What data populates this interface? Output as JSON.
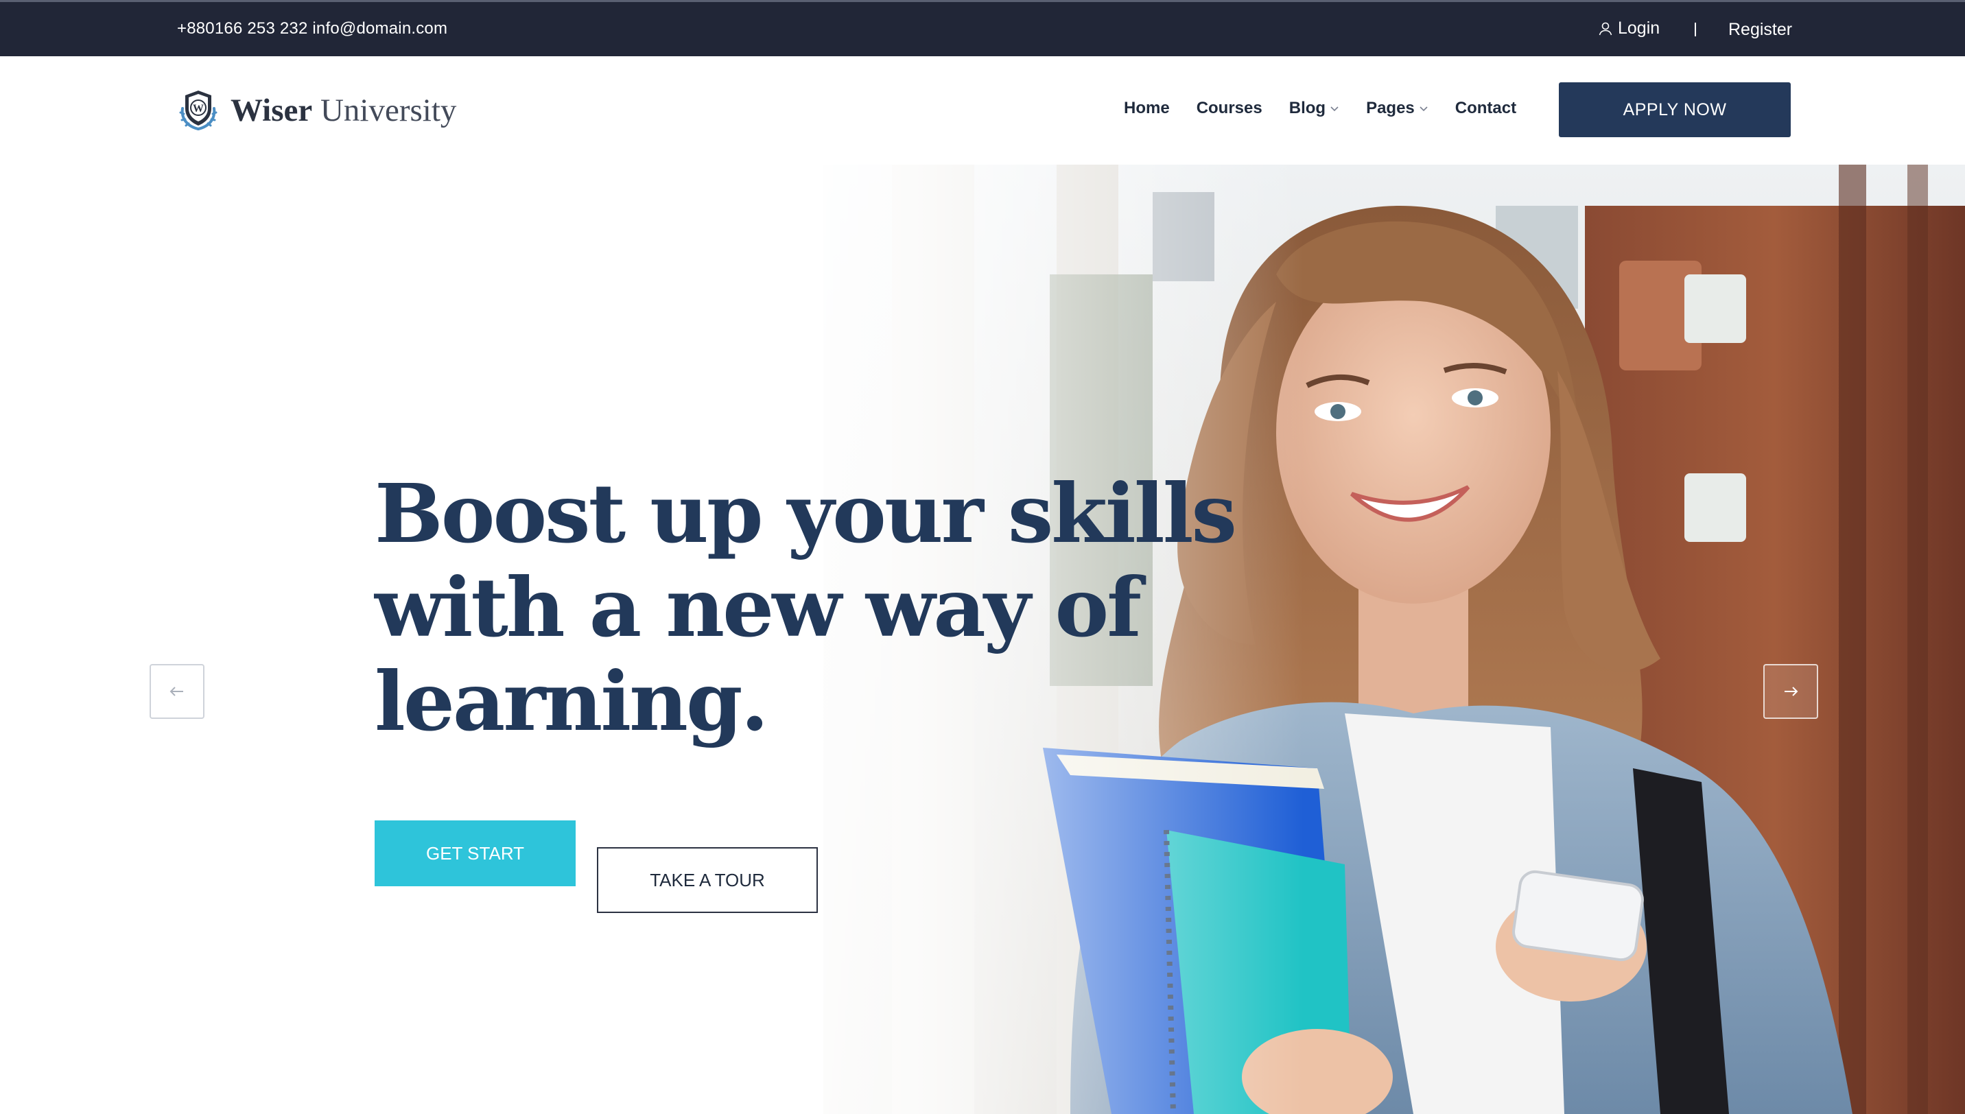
{
  "topbar": {
    "contact": "+880166 253 232 info@domain.com",
    "login_label": "Login",
    "register_label": "Register"
  },
  "header": {
    "logo_bold": "Wiser",
    "logo_light": "University",
    "logo_initial": "W",
    "nav": [
      {
        "label": "Home"
      },
      {
        "label": "Courses"
      },
      {
        "label": "Blog"
      },
      {
        "label": "Pages"
      },
      {
        "label": "Contact"
      }
    ],
    "apply_label": "APPLY NOW"
  },
  "hero": {
    "headline": [
      "Boost up your skills",
      "with a new way of",
      "learning."
    ],
    "get_start_label": "GET START",
    "take_tour_label": "TAKE A TOUR"
  },
  "icons": {
    "login": "user-icon",
    "prev": "arrow-left-icon",
    "next": "arrow-right-icon",
    "dropdown": "chevron-down-icon"
  },
  "colors": {
    "topbar_bg": "#212637",
    "brand_navy": "#24395a",
    "accent_cyan": "#2ec4da",
    "headline": "#22395a"
  }
}
